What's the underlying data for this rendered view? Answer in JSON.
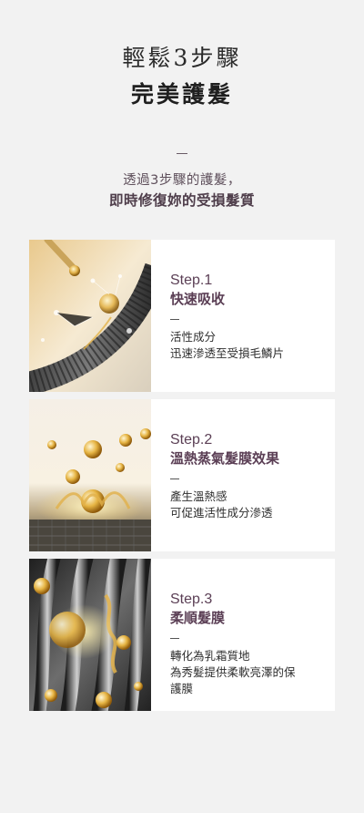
{
  "header": {
    "title_line1": "輕鬆3步驟",
    "title_line2": "完美護髮",
    "subtitle_line1": "透過3步驟的護髮，",
    "subtitle_line2": "即時修復妳的受損髮質"
  },
  "steps": [
    {
      "label": "Step.1",
      "title": "快速吸收",
      "desc_lines": [
        "活性成分",
        "迅速滲透至受損毛鱗片"
      ]
    },
    {
      "label": "Step.2",
      "title": "溫熱蒸氣髮膜效果",
      "desc_lines": [
        "產生溫熱感",
        "可促進活性成分滲透"
      ]
    },
    {
      "label": "Step.3",
      "title": "柔順髮膜",
      "desc_lines": [
        "轉化為乳霜質地",
        "為秀髮提供柔軟亮澤的保",
        "護膜"
      ]
    }
  ],
  "colors": {
    "page_bg": "#f2f2f2",
    "card_bg": "#ffffff",
    "accent_plum": "#5b3f55",
    "gold": "#e3b34a"
  }
}
